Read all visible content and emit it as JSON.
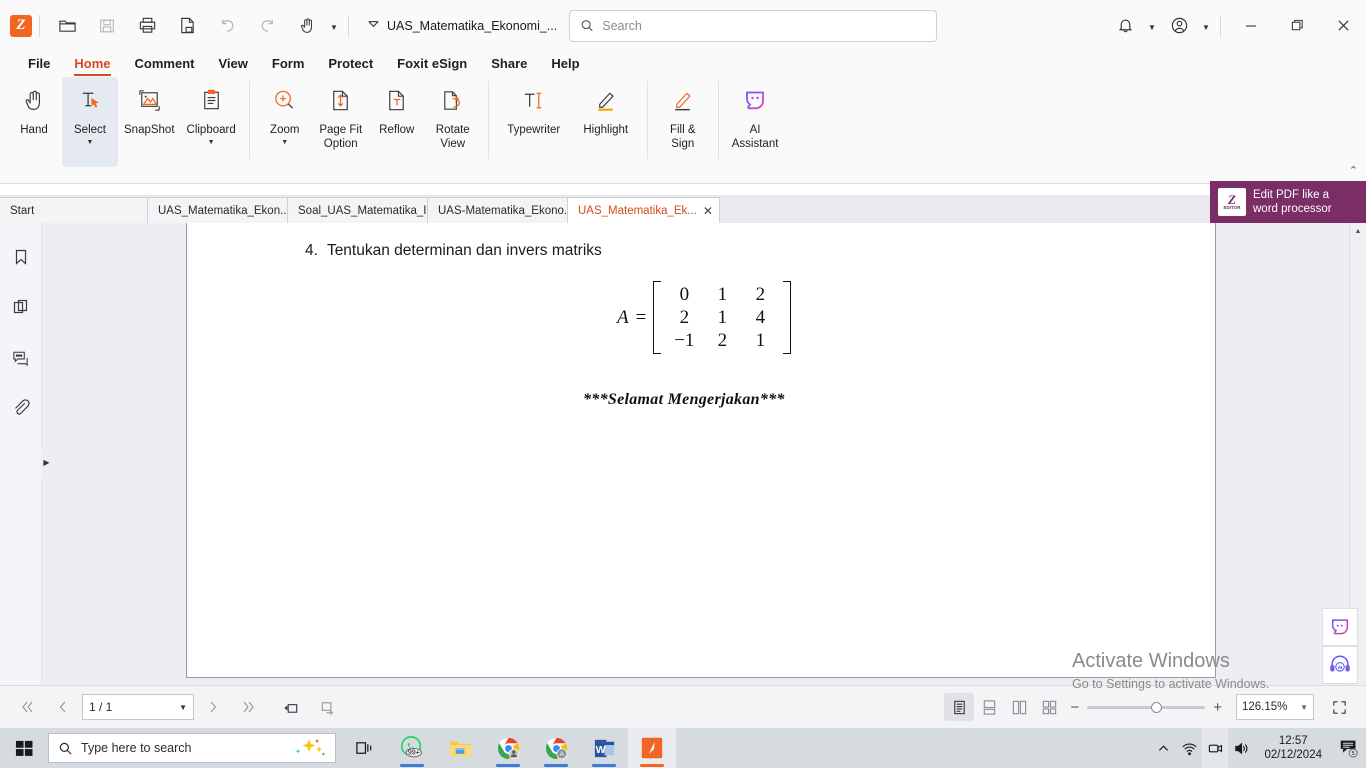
{
  "titlebar": {
    "app_logo": "foxit-logo-icon",
    "document_title": "UAS_Matematika_Ekonomi_...",
    "search_placeholder": "Search",
    "search_value": "",
    "tools": [
      "open-icon",
      "save-icon",
      "print-icon",
      "export-icon",
      "undo-icon",
      "redo-icon",
      "hand-tool-icon"
    ]
  },
  "menubar": {
    "items": [
      {
        "label": "File",
        "active": false
      },
      {
        "label": "Home",
        "active": true
      },
      {
        "label": "Comment",
        "active": false
      },
      {
        "label": "View",
        "active": false
      },
      {
        "label": "Form",
        "active": false
      },
      {
        "label": "Protect",
        "active": false
      },
      {
        "label": "Foxit eSign",
        "active": false
      },
      {
        "label": "Share",
        "active": false
      },
      {
        "label": "Help",
        "active": false
      }
    ]
  },
  "ribbon": {
    "buttons": [
      {
        "label": "Hand",
        "icon": "hand-icon",
        "caret": false,
        "selected": false
      },
      {
        "label": "Select",
        "icon": "select-text-icon",
        "caret": true,
        "selected": true
      },
      {
        "label": "SnapShot",
        "icon": "snapshot-icon",
        "caret": false,
        "selected": false
      },
      {
        "label": "Clipboard",
        "icon": "clipboard-icon",
        "caret": true,
        "selected": false
      },
      {
        "label": "Zoom",
        "icon": "zoom-in-icon",
        "caret": true,
        "selected": false
      },
      {
        "label": "Page Fit\nOption",
        "icon": "page-fit-icon",
        "caret": true,
        "selected": false
      },
      {
        "label": "Reflow",
        "icon": "reflow-icon",
        "caret": false,
        "selected": false
      },
      {
        "label": "Rotate\nView",
        "icon": "rotate-view-icon",
        "caret": true,
        "selected": false
      },
      {
        "label": "Typewriter",
        "icon": "typewriter-icon",
        "caret": false,
        "selected": false
      },
      {
        "label": "Highlight",
        "icon": "highlight-icon",
        "caret": false,
        "selected": false
      },
      {
        "label": "Fill &\nSign",
        "icon": "fill-sign-icon",
        "caret": false,
        "selected": false
      },
      {
        "label": "AI\nAssistant",
        "icon": "ai-assistant-icon",
        "caret": false,
        "selected": false
      }
    ]
  },
  "tabstrip": {
    "tabs": [
      {
        "label": "Start",
        "active": false,
        "closable": false
      },
      {
        "label": "UAS_Matematika_Ekon...",
        "active": false,
        "closable": false
      },
      {
        "label": "Soal_UAS_Matematika_I...",
        "active": false,
        "closable": false
      },
      {
        "label": "UAS-Matematika_Ekono...",
        "active": false,
        "closable": false
      },
      {
        "label": "UAS_Matematika_Ek...",
        "active": true,
        "closable": true
      }
    ],
    "close_glyph": "✕",
    "promo": {
      "line1": "Edit PDF like a",
      "line2": "word processor",
      "badge_label": "EDITOR"
    }
  },
  "sidebar": {
    "items": [
      {
        "name": "bookmarks-icon"
      },
      {
        "name": "page-thumbnails-icon"
      },
      {
        "name": "comments-icon"
      },
      {
        "name": "attachments-icon"
      }
    ]
  },
  "document": {
    "question_number": "4.",
    "question_text": "Tentukan determinan dan invers matriks",
    "matrix_label": "A",
    "matrix_equals": "=",
    "matrix_rows": [
      [
        "0",
        "1",
        "2"
      ],
      [
        "2",
        "1",
        "4"
      ],
      [
        "−1",
        "2",
        "1"
      ]
    ],
    "closing_text": "***Selamat Mengerjakan***"
  },
  "watermark": {
    "line1": "Activate Windows",
    "line2": "Go to Settings to activate Windows."
  },
  "float_buttons": [
    {
      "name": "ai-chat-bubble-icon"
    },
    {
      "name": "ai-support-headset-icon"
    }
  ],
  "statusbar": {
    "page_value": "1 / 1",
    "zoom_value": "126.15%",
    "nav": [
      "first-page-icon",
      "previous-page-icon",
      "next-page-icon",
      "last-page-icon",
      "previous-view-icon",
      "next-view-icon"
    ],
    "view_modes": [
      {
        "name": "single-page-view-icon",
        "active": true
      },
      {
        "name": "continuous-view-icon",
        "active": false
      },
      {
        "name": "two-page-view-icon",
        "active": false
      },
      {
        "name": "two-page-continuous-view-icon",
        "active": false
      }
    ],
    "zoom_out_label": "−",
    "zoom_in_label": "+",
    "fullscreen": "fullscreen-icon"
  },
  "taskbar": {
    "start": "windows-start-icon",
    "search_placeholder": "Type here to search",
    "task_view": "task-view-icon",
    "apps": [
      {
        "name": "whatsapp-icon",
        "badge": "99+",
        "running": true,
        "active": false
      },
      {
        "name": "file-explorer-icon",
        "badge": "",
        "running": false,
        "active": false
      },
      {
        "name": "chrome-icon",
        "badge": "",
        "running": true,
        "active": false
      },
      {
        "name": "chrome-profile-icon",
        "badge": "",
        "running": true,
        "active": false
      },
      {
        "name": "word-icon",
        "badge": "",
        "running": true,
        "active": false
      },
      {
        "name": "foxit-pdf-icon",
        "badge": "",
        "running": true,
        "active": true
      }
    ],
    "tray": [
      "show-hidden-icons-icon",
      "network-icon",
      "screen-record-icon",
      "volume-icon"
    ],
    "clock_time": "12:57",
    "clock_date": "02/12/2024",
    "notification_count": "5"
  },
  "colors": {
    "accent_orange": "#d4491f",
    "logo_orange": "#f26522",
    "promo_purple": "#7b2d65",
    "taskbar": "#d6dbe0"
  }
}
